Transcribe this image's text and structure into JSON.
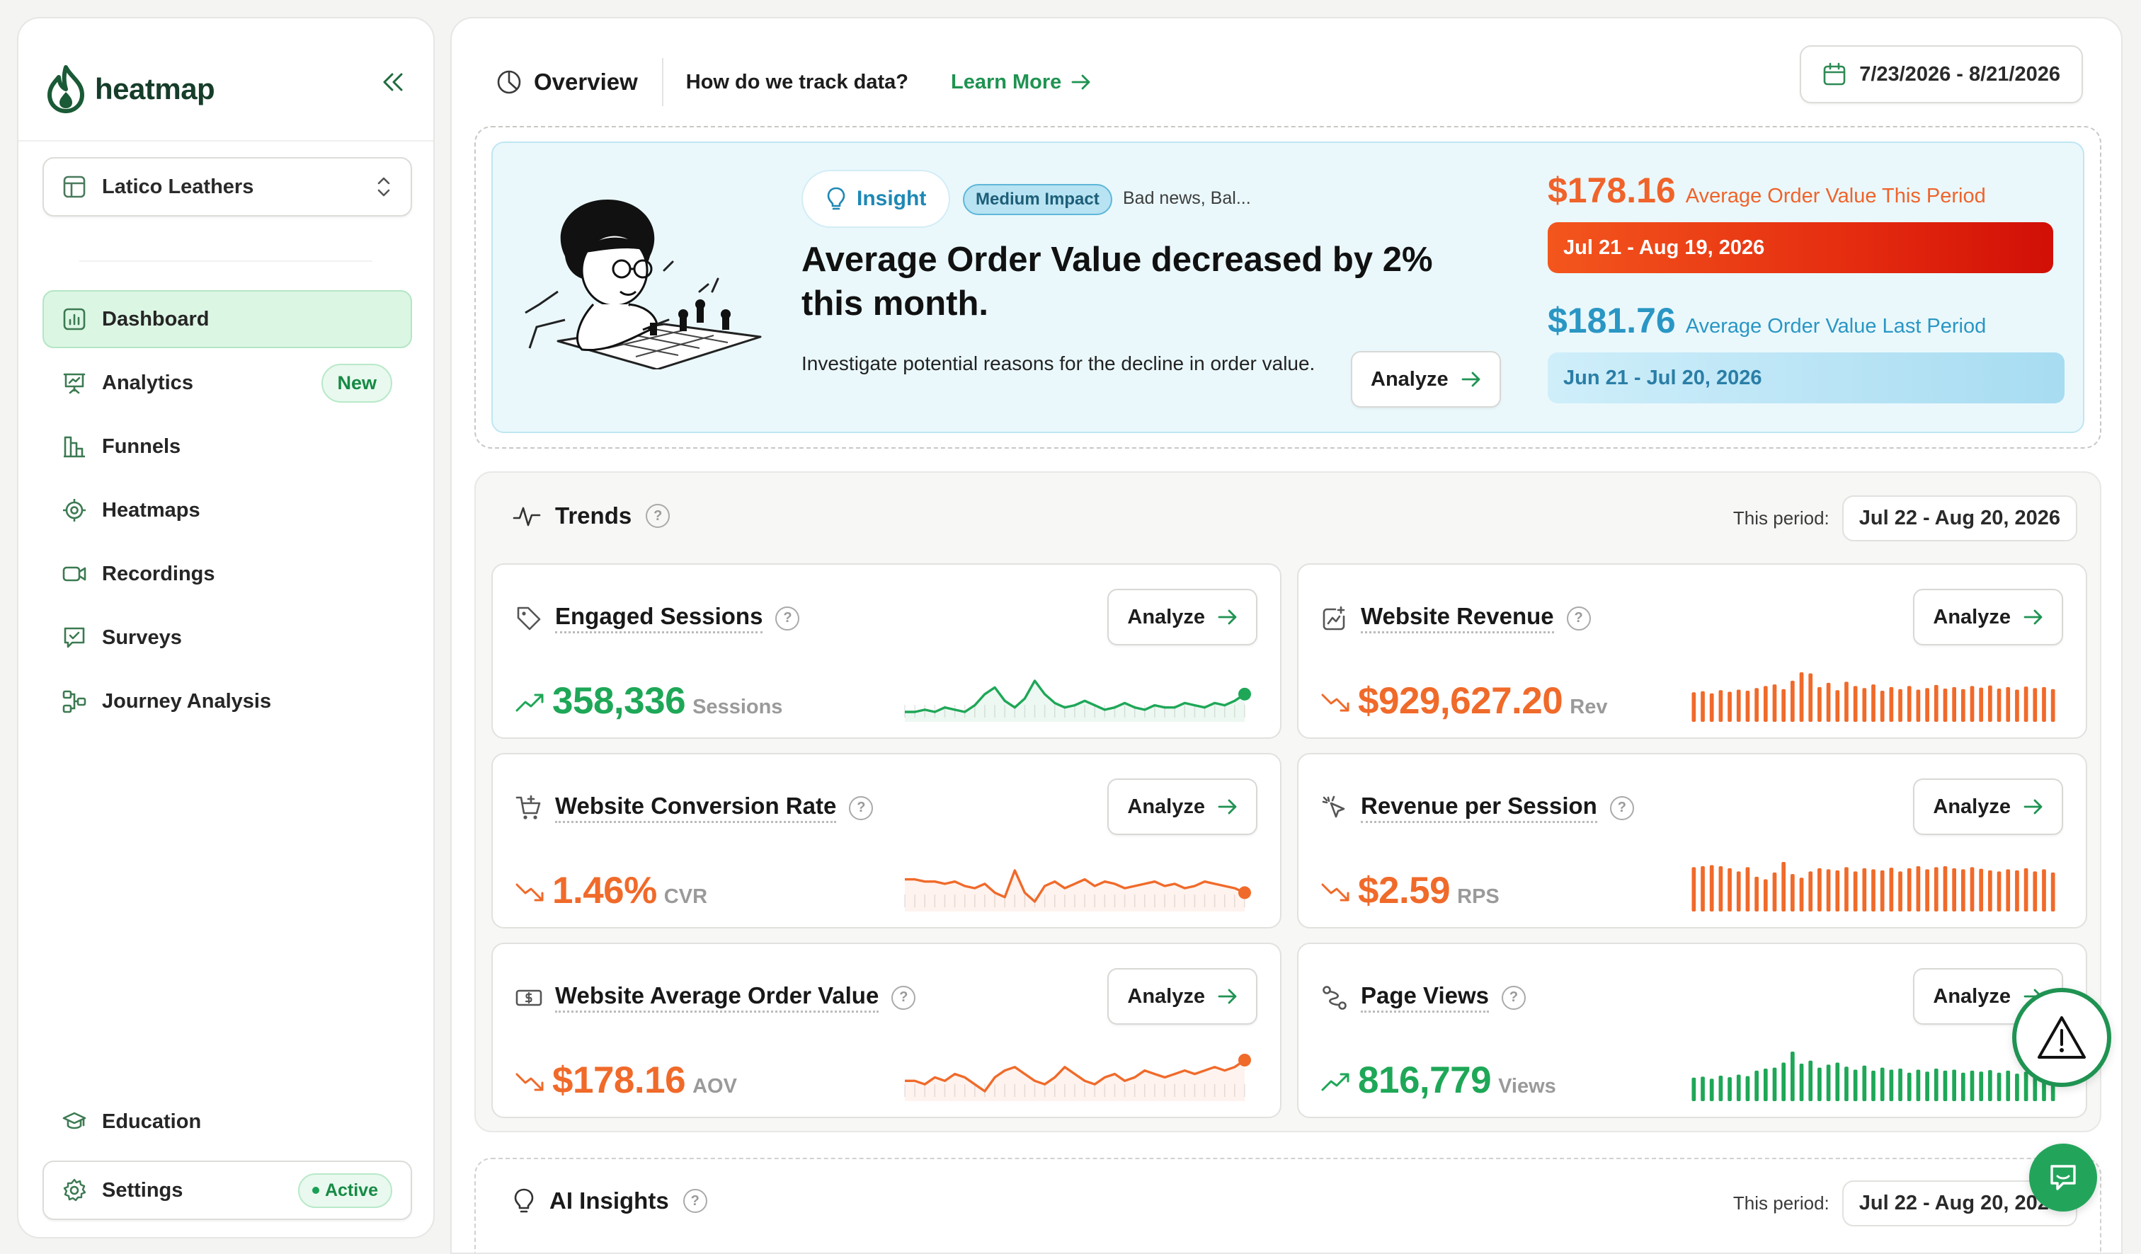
{
  "brand": {
    "name": "heatmap"
  },
  "site_selector": {
    "label": "Latico Leathers"
  },
  "nav": [
    {
      "label": "Dashboard",
      "icon": "bar-chart-icon",
      "active": true
    },
    {
      "label": "Analytics",
      "icon": "presentation-chart-icon",
      "badge": "New"
    },
    {
      "label": "Funnels",
      "icon": "funnel-bars-icon"
    },
    {
      "label": "Heatmaps",
      "icon": "target-icon"
    },
    {
      "label": "Recordings",
      "icon": "video-camera-icon"
    },
    {
      "label": "Surveys",
      "icon": "survey-check-icon"
    },
    {
      "label": "Journey Analysis",
      "icon": "journey-flow-icon"
    }
  ],
  "education": {
    "label": "Education"
  },
  "settings": {
    "label": "Settings",
    "status": "Active"
  },
  "topbar": {
    "overview": "Overview",
    "question": "How do we track data?",
    "learn_more": "Learn More",
    "date_range": "7/23/2026 - 8/21/2026"
  },
  "insight": {
    "tag": "Insight",
    "impact": "Medium Impact",
    "note": "Bad news, Bal...",
    "title": "Average Order Value decreased by 2% this month.",
    "description": "Investigate potential reasons for the decline in order value.",
    "analyze": "Analyze",
    "current": {
      "value": "$178.16",
      "label": "Average Order Value This Period",
      "period": "Jul 21 - Aug 19, 2026"
    },
    "previous": {
      "value": "$181.76",
      "label": "Average Order Value Last Period",
      "period": "Jun 21 - Jul 20, 2026"
    }
  },
  "trends": {
    "title": "Trends",
    "period_label": "This period:",
    "period_value": "Jul 22 - Aug 20, 2026",
    "analyze": "Analyze",
    "cards": [
      {
        "title": "Engaged Sessions",
        "value": "358,336",
        "unit": "Sessions",
        "trend": "up",
        "icon": "tag-icon",
        "chart": "line",
        "color": "#1ea757",
        "series": [
          50,
          50,
          51,
          50,
          52,
          51,
          50,
          53,
          58,
          61,
          55,
          52,
          56,
          64,
          58,
          54,
          52,
          53,
          55,
          53,
          51,
          52,
          54,
          52,
          51,
          53,
          52,
          52,
          54,
          53,
          52,
          54,
          53,
          55,
          58
        ]
      },
      {
        "title": "Website Revenue",
        "value": "$929,627.20",
        "unit": "Rev",
        "trend": "down",
        "icon": "chart-image-icon",
        "chart": "bar",
        "color": "#f06a2a",
        "series": [
          40,
          42,
          38,
          44,
          41,
          45,
          43,
          48,
          52,
          55,
          46,
          62,
          78,
          76,
          50,
          58,
          44,
          60,
          52,
          48,
          55,
          43,
          50,
          46,
          52,
          45,
          48,
          54,
          47,
          50,
          46,
          52,
          49,
          53,
          47,
          50,
          45,
          51,
          48,
          50,
          46
        ]
      },
      {
        "title": "Website Conversion Rate",
        "value": "1.46%",
        "unit": "CVR",
        "trend": "down",
        "icon": "shopping-cart-icon",
        "chart": "line",
        "color": "#f06a2a",
        "series": [
          56,
          56,
          55,
          55,
          54,
          55,
          53,
          52,
          54,
          50,
          48,
          60,
          50,
          46,
          53,
          55,
          52,
          54,
          56,
          53,
          55,
          54,
          52,
          53,
          54,
          55,
          53,
          54,
          52,
          53,
          55,
          54,
          53,
          52,
          50
        ]
      },
      {
        "title": "Revenue per Session",
        "value": "$2.59",
        "unit": "RPS",
        "trend": "down",
        "icon": "cursor-click-icon",
        "chart": "bar",
        "color": "#f06a2a",
        "series": [
          68,
          70,
          72,
          70,
          66,
          60,
          68,
          50,
          45,
          58,
          78,
          55,
          48,
          60,
          66,
          64,
          62,
          68,
          60,
          66,
          64,
          62,
          67,
          60,
          66,
          70,
          64,
          68,
          70,
          66,
          64,
          68,
          65,
          62,
          60,
          64,
          62,
          66,
          60,
          64,
          58
        ]
      },
      {
        "title": "Website Average Order Value",
        "value": "$178.16",
        "unit": "AOV",
        "trend": "down",
        "icon": "dollar-bill-icon",
        "chart": "line",
        "color": "#f06a2a",
        "series": [
          52,
          52,
          51,
          53,
          52,
          54,
          53,
          51,
          49,
          53,
          55,
          56,
          54,
          52,
          51,
          53,
          56,
          54,
          52,
          51,
          53,
          54,
          52,
          53,
          55,
          54,
          53,
          54,
          55,
          54,
          55,
          56,
          55,
          56,
          58
        ]
      },
      {
        "title": "Page Views",
        "value": "816,779",
        "unit": "Views",
        "trend": "up",
        "icon": "route-icon",
        "chart": "bar",
        "color": "#1ea757",
        "series": [
          30,
          32,
          28,
          34,
          31,
          36,
          33,
          44,
          48,
          50,
          60,
          82,
          58,
          64,
          50,
          56,
          60,
          52,
          46,
          54,
          44,
          50,
          46,
          48,
          40,
          46,
          42,
          48,
          44,
          46,
          40,
          44,
          42,
          45,
          40,
          44,
          38,
          42,
          40,
          44,
          38
        ]
      }
    ]
  },
  "ai_insights": {
    "title": "AI Insights",
    "period_label": "This period:",
    "period_value": "Jul 22 - Aug 20, 2026"
  },
  "colors": {
    "brand": "#1f9352",
    "up": "#1ea757",
    "down": "#f06a2a",
    "insight_bg": "#eaf8fc",
    "prev_blue": "#2a96c4"
  }
}
